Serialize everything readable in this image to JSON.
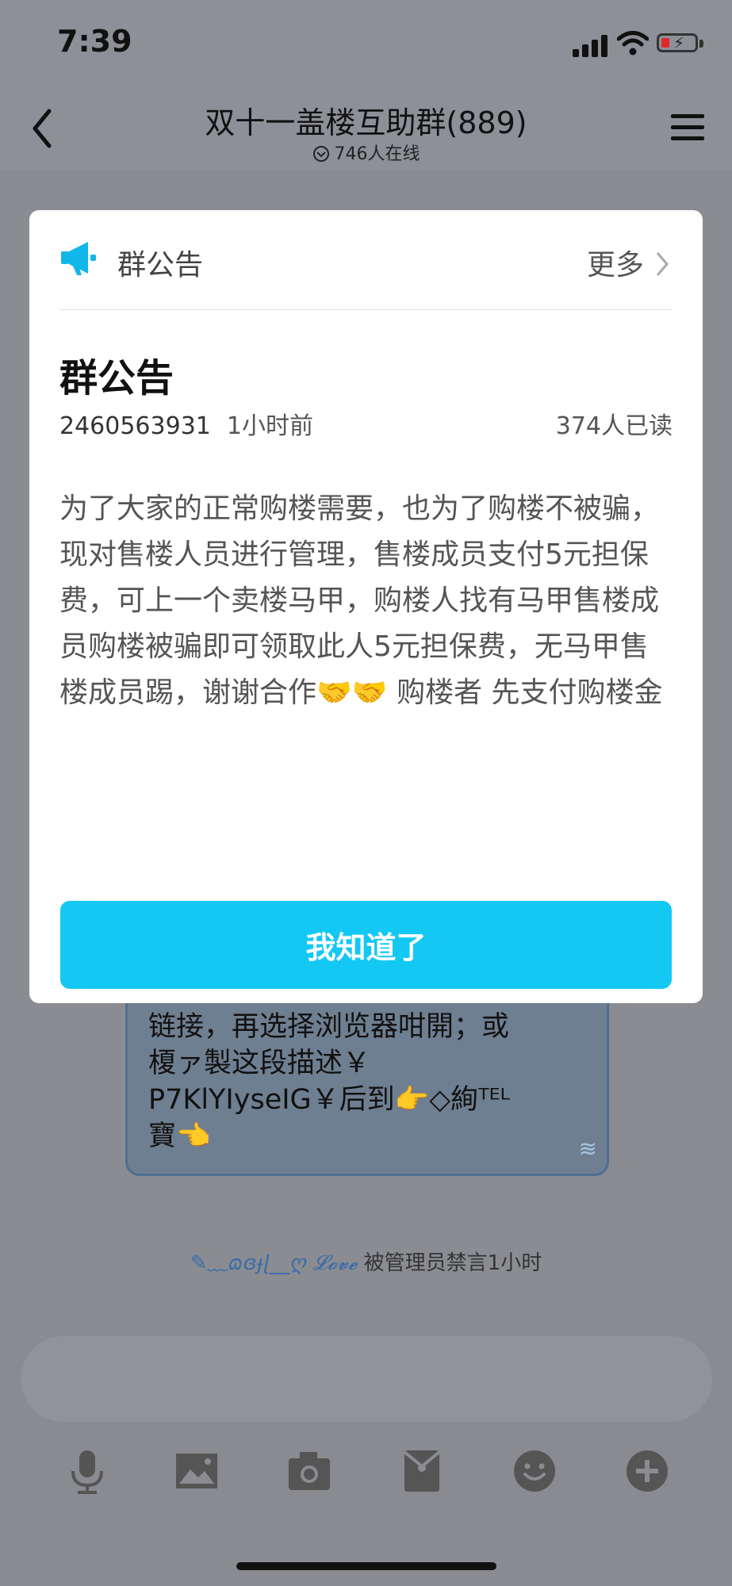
{
  "status_bar": {
    "time": "7:39"
  },
  "nav": {
    "title": "双十一盖楼互助群(889)",
    "online_count": "746人在线"
  },
  "chat": {
    "bubble_lines": [
      "链接，再选择浏览器咁開；或",
      "榎ァ製这段描述￥",
      "P7KlYIyseIG￥后到👉◇絢ᵀᴱᴸ",
      "寶👈"
    ],
    "system_user": "✎﹏ɷɞɟɭ__ღ 𝓛𝓸𝓿𝓮",
    "system_text": "被管理员禁言1小时"
  },
  "toolbar": {
    "icons": [
      "microphone-icon",
      "image-icon",
      "camera-icon",
      "red-packet-icon",
      "emoji-icon",
      "plus-icon"
    ]
  },
  "dialog": {
    "header_title": "群公告",
    "more_label": "更多",
    "notice_title": "群公告",
    "author_id": "2460563931",
    "time_ago": "1小时前",
    "read_count": "374人已读",
    "body": "为了大家的正常购楼需要，也为了购楼不被骗，现对售楼人员进行管理，售楼成员支付5元担保费，可上一个卖楼马甲，购楼人找有马甲售楼成员购楼被骗即可领取此人5元担保费，无马甲售楼成员踢，谢谢合作🤝🤝 购楼者 先支付购楼金",
    "confirm_label": "我知道了",
    "accent_color": "#14c8f4"
  }
}
